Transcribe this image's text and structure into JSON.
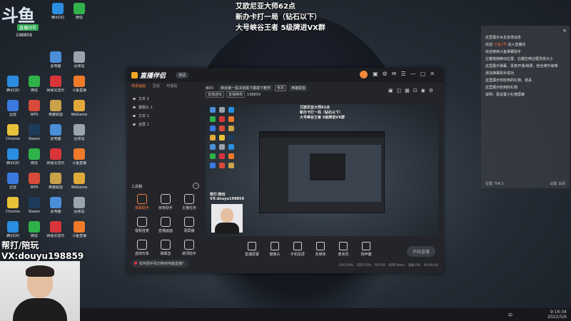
{
  "desktop": {
    "logo_text": "斗鱼",
    "room_badge": "直播间号",
    "room_number": "198859",
    "overlay_lines": [
      "艾欧尼亚大师62点",
      "新办卡打一局（钻石以下）",
      "大号峡谷王者 5级牌进VX群"
    ],
    "promo_lines": [
      "帮打/陪玩",
      "VX:douyu198859"
    ],
    "icons": [
      {
        "label": "此电脑",
        "color": "#4a8fd8"
      },
      {
        "label": "回收站",
        "color": "#9aa4ad"
      },
      {
        "label": "腾讯QQ",
        "color": "#2b8de0"
      },
      {
        "label": "微信",
        "color": "#2fb24a"
      },
      {
        "label": "网易云音乐",
        "color": "#d8353a"
      },
      {
        "label": "斗鱼直播",
        "color": "#f07a2a"
      },
      {
        "label": "迅雷",
        "color": "#3a7ae0"
      },
      {
        "label": "WPS",
        "color": "#d84a3a"
      },
      {
        "label": "英雄联盟",
        "color": "#c9a24a"
      },
      {
        "label": "WeGame",
        "color": "#e0a93a"
      },
      {
        "label": "Chrome",
        "color": "#e8c33a"
      },
      {
        "label": "Steam",
        "color": "#1d3b5a"
      }
    ]
  },
  "app": {
    "brand": "直播伴侣",
    "version_badge": "测试",
    "left_tabs": [
      "场景画面",
      "互动",
      "可道具"
    ],
    "scenes": [
      "文本 2",
      "摄像头 1",
      "文本 1",
      "全屏 1"
    ],
    "toolbox_title": "工具箱",
    "tools": [
      "弹幕助手",
      "房管助手",
      "主播任务",
      "视频连麦",
      "直播画面",
      "录屏播",
      "虚拟形象",
      "弹幕音",
      "歌词助手"
    ],
    "tip": "如何把手机切换到电脑直播？",
    "room_label": "房间：",
    "room_title": "峡谷第一看决单挑下路镜下教学",
    "room_edit": "修改",
    "room_category": "英雄联盟",
    "room_tags": [
      "直播游戏",
      "直播推荐"
    ],
    "room_id_text": "198859",
    "controls": [
      "直播屏幕",
      "摄像头",
      "手机投屏",
      "多媒体",
      "麦克风",
      "扬声器"
    ],
    "go_live": "开始直播",
    "status": [
      "CPU:20%",
      "内存:53%",
      "FPS:60",
      "码率:0kb/s",
      "丢帧:0%",
      "00:00:00"
    ]
  },
  "chat": {
    "close": "×",
    "messages": [
      "这里展示水友进场消息",
      "欢迎 斗鱼1号 进入直播间",
      "欢迎使用斗鱼弹幕助手",
      "左键拖拽移动位置，右键拉伸边框改变大小",
      "这里展示弹幕、贵族开通/续费、粉丝牌升级等",
      "添加弹幕助手成功",
      "这里展示你收到的礼物、道具",
      "这里展示收到的礼物",
      "说明：需设置小礼物屏蔽"
    ],
    "highlight_name": "斗鱼1号",
    "footer_left": "位置 704,1",
    "footer_right": "设置 关闭"
  },
  "taskbar": {
    "ime": "中",
    "time": "9:16:34",
    "date": "2022/5/6"
  }
}
